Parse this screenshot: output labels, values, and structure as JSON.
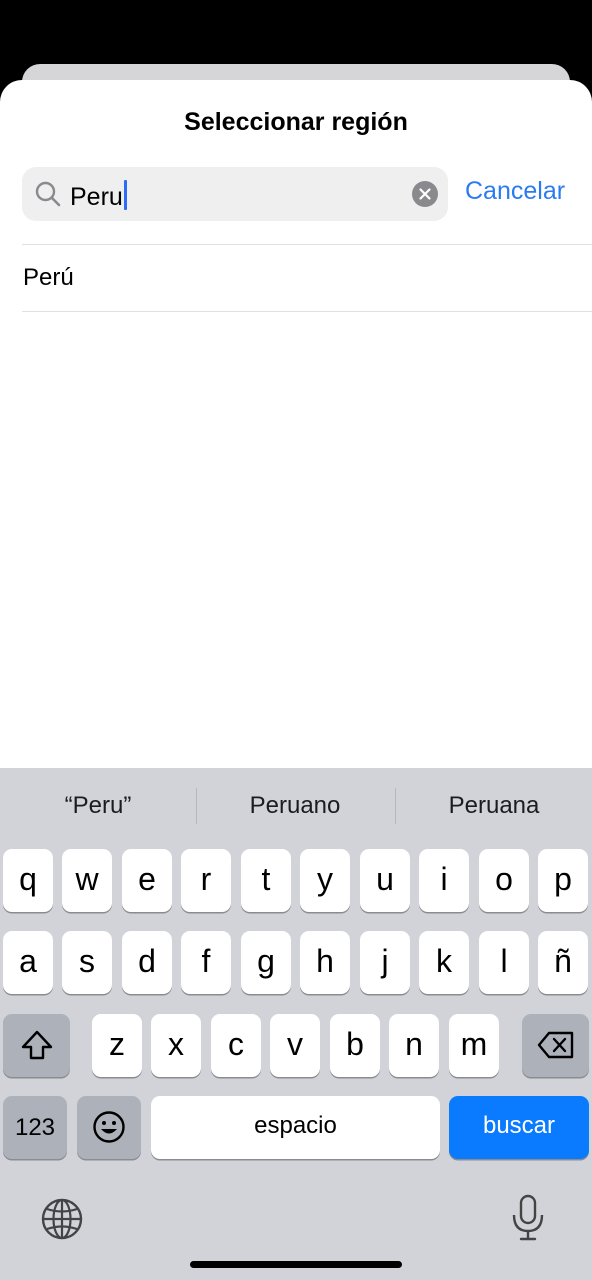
{
  "sheet": {
    "title": "Seleccionar región",
    "search": {
      "value": "Peru",
      "icon": "search-icon",
      "clear_icon": "clear-icon"
    },
    "cancel_label": "Cancelar",
    "results": [
      "Perú"
    ]
  },
  "keyboard": {
    "suggestions": [
      "“Peru”",
      "Peruano",
      "Peruana"
    ],
    "row1": [
      "q",
      "w",
      "e",
      "r",
      "t",
      "y",
      "u",
      "i",
      "o",
      "p"
    ],
    "row2": [
      "a",
      "s",
      "d",
      "f",
      "g",
      "h",
      "j",
      "k",
      "l",
      "ñ"
    ],
    "row3": [
      "z",
      "x",
      "c",
      "v",
      "b",
      "n",
      "m"
    ],
    "numbers_label": "123",
    "space_label": "espacio",
    "return_label": "buscar",
    "icons": {
      "shift": "shift-icon",
      "delete": "backspace-icon",
      "emoji": "emoji-icon",
      "globe": "globe-icon",
      "mic": "microphone-icon"
    },
    "accent_color": "#0a7aff"
  }
}
